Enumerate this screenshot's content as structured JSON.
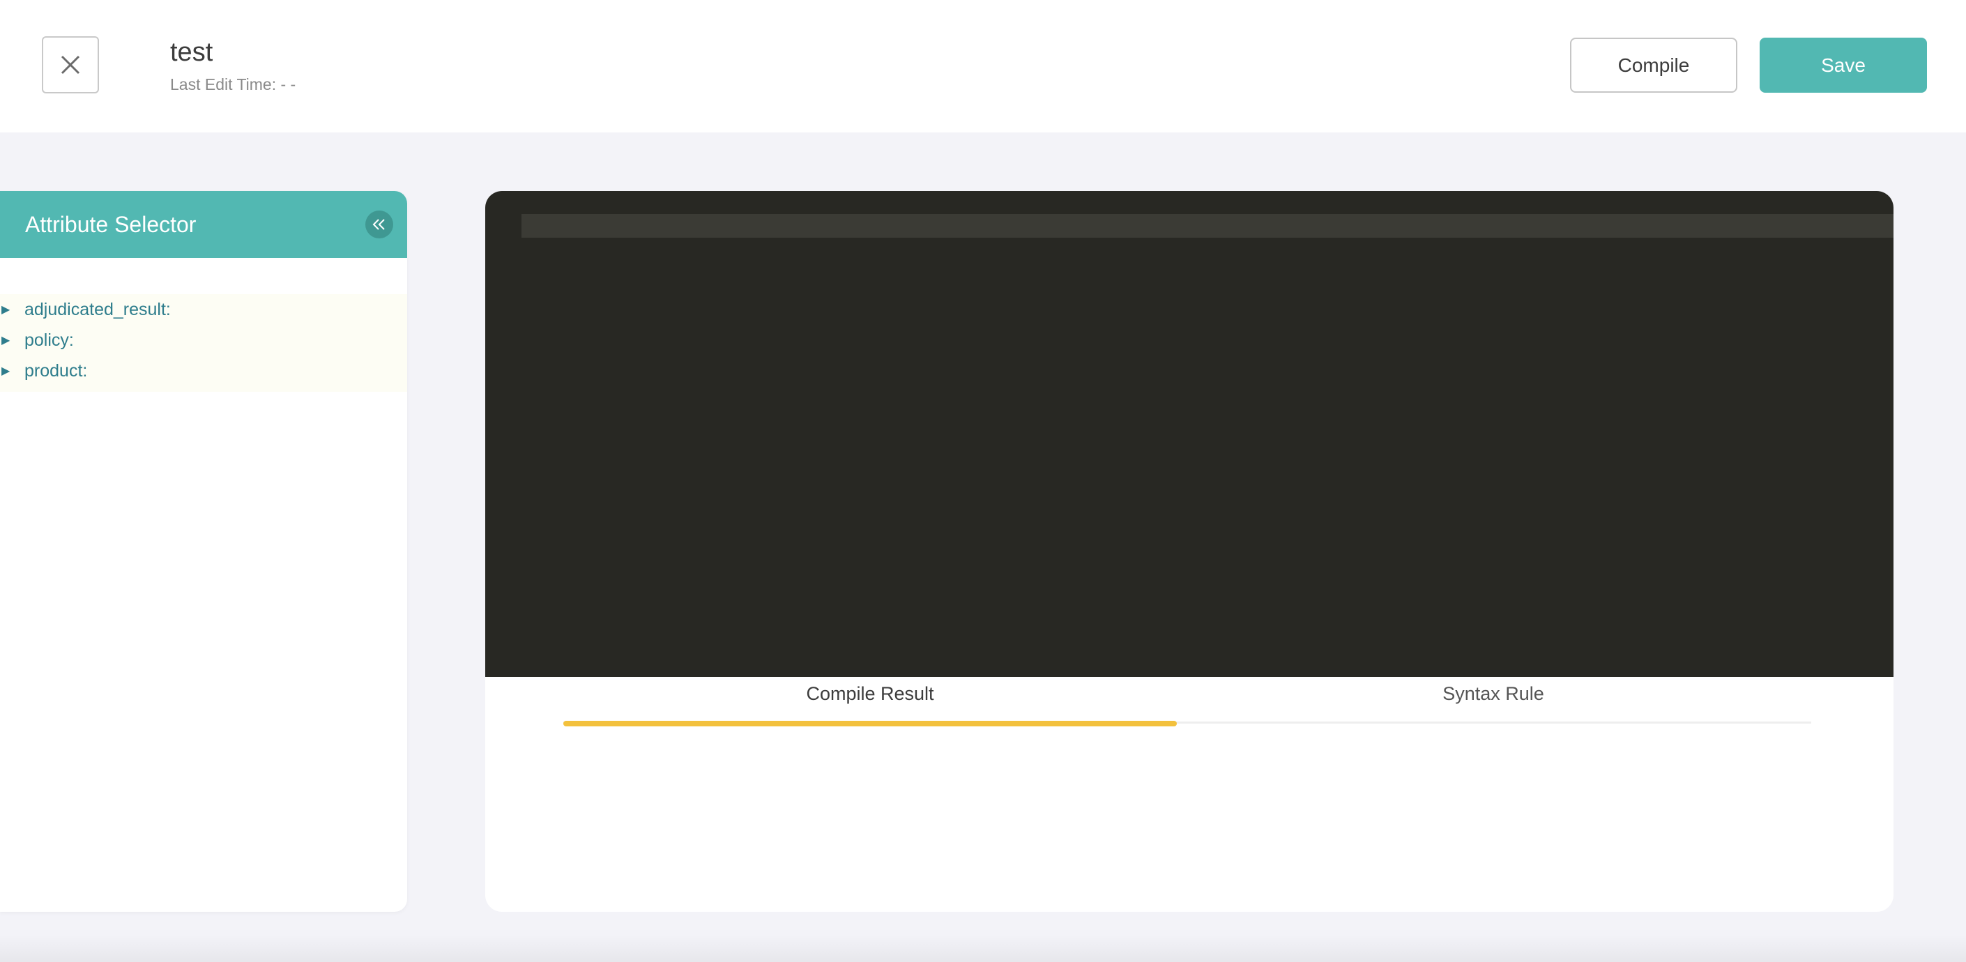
{
  "header": {
    "title": "test",
    "last_edit": "Last Edit Time: - -",
    "compile_label": "Compile",
    "save_label": "Save",
    "colors": {
      "accent": "#52b8b2"
    }
  },
  "attribute_selector": {
    "title": "Attribute Selector",
    "items": [
      {
        "label": "adjudicated_result:"
      },
      {
        "label": "policy:"
      },
      {
        "label": "product:"
      }
    ]
  },
  "editor": {
    "background": "#282823",
    "tabs": [
      {
        "label": "Compile Result",
        "active": true
      },
      {
        "label": "Syntax Rule",
        "active": false
      }
    ],
    "tab_indicator_color": "#f3c13d"
  },
  "icons": {
    "close": "close-icon",
    "collapse": "double-chevron-left-icon",
    "tree_expand": "triangle-right-icon"
  }
}
